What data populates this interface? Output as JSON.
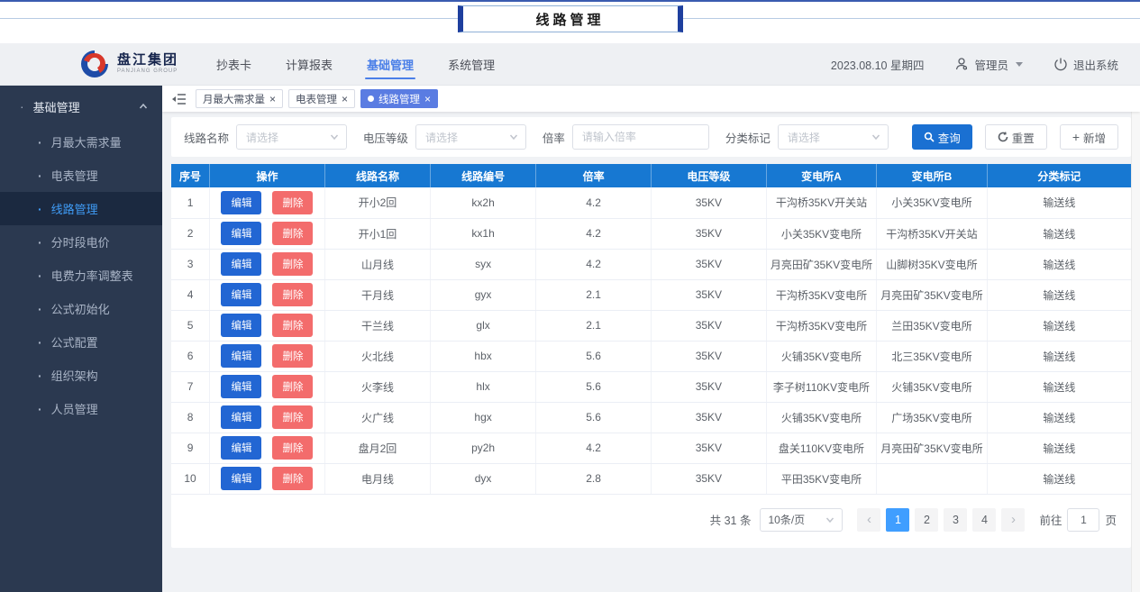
{
  "page_title": "线路管理",
  "header": {
    "logo_cn": "盘江集团",
    "logo_en": "PANJIANG GROUP",
    "nav": [
      {
        "label": "抄表卡",
        "active": false
      },
      {
        "label": "计算报表",
        "active": false
      },
      {
        "label": "基础管理",
        "active": true
      },
      {
        "label": "系统管理",
        "active": false
      }
    ],
    "date": "2023.08.10 星期四",
    "user": "管理员",
    "logout": "退出系统"
  },
  "sidebar": {
    "group_label": "基础管理",
    "items": [
      {
        "label": "月最大需求量",
        "active": false
      },
      {
        "label": "电表管理",
        "active": false
      },
      {
        "label": "线路管理",
        "active": true
      },
      {
        "label": "分时段电价",
        "active": false
      },
      {
        "label": "电费力率调整表",
        "active": false
      },
      {
        "label": "公式初始化",
        "active": false
      },
      {
        "label": "公式配置",
        "active": false
      },
      {
        "label": "组织架构",
        "active": false
      },
      {
        "label": "人员管理",
        "active": false
      }
    ]
  },
  "tabs": [
    {
      "label": "月最大需求量",
      "active": false
    },
    {
      "label": "电表管理",
      "active": false
    },
    {
      "label": "线路管理",
      "active": true
    }
  ],
  "filters": {
    "line_name_label": "线路名称",
    "line_name_placeholder": "请选择",
    "voltage_label": "电压等级",
    "voltage_placeholder": "请选择",
    "ratio_label": "倍率",
    "ratio_placeholder": "请输入倍率",
    "category_label": "分类标记",
    "category_placeholder": "请选择",
    "search_button": "查询",
    "reset_button": "重置",
    "add_button": "新增"
  },
  "table": {
    "headers": [
      "序号",
      "操作",
      "线路名称",
      "线路编号",
      "倍率",
      "电压等级",
      "变电所A",
      "变电所B",
      "分类标记"
    ],
    "edit_label": "编辑",
    "delete_label": "删除",
    "rows": [
      {
        "no": "1",
        "name": "开小2回",
        "code": "kx2h",
        "ratio": "4.2",
        "voltage": "35KV",
        "sub_a": "干沟桥35KV开关站",
        "sub_b": "小关35KV变电所",
        "category": "输送线"
      },
      {
        "no": "2",
        "name": "开小1回",
        "code": "kx1h",
        "ratio": "4.2",
        "voltage": "35KV",
        "sub_a": "小关35KV变电所",
        "sub_b": "干沟桥35KV开关站",
        "category": "输送线"
      },
      {
        "no": "3",
        "name": "山月线",
        "code": "syx",
        "ratio": "4.2",
        "voltage": "35KV",
        "sub_a": "月亮田矿35KV变电所",
        "sub_b": "山脚树35KV变电所",
        "category": "输送线"
      },
      {
        "no": "4",
        "name": "干月线",
        "code": "gyx",
        "ratio": "2.1",
        "voltage": "35KV",
        "sub_a": "干沟桥35KV变电所",
        "sub_b": "月亮田矿35KV变电所",
        "category": "输送线"
      },
      {
        "no": "5",
        "name": "干兰线",
        "code": "glx",
        "ratio": "2.1",
        "voltage": "35KV",
        "sub_a": "干沟桥35KV变电所",
        "sub_b": "兰田35KV变电所",
        "category": "输送线"
      },
      {
        "no": "6",
        "name": "火北线",
        "code": "hbx",
        "ratio": "5.6",
        "voltage": "35KV",
        "sub_a": "火铺35KV变电所",
        "sub_b": "北三35KV变电所",
        "category": "输送线"
      },
      {
        "no": "7",
        "name": "火李线",
        "code": "hlx",
        "ratio": "5.6",
        "voltage": "35KV",
        "sub_a": "李子树110KV变电所",
        "sub_b": "火铺35KV变电所",
        "category": "输送线"
      },
      {
        "no": "8",
        "name": "火广线",
        "code": "hgx",
        "ratio": "5.6",
        "voltage": "35KV",
        "sub_a": "火铺35KV变电所",
        "sub_b": "广场35KV变电所",
        "category": "输送线"
      },
      {
        "no": "9",
        "name": "盘月2回",
        "code": "py2h",
        "ratio": "4.2",
        "voltage": "35KV",
        "sub_a": "盘关110KV变电所",
        "sub_b": "月亮田矿35KV变电所",
        "category": "输送线"
      },
      {
        "no": "10",
        "name": "电月线",
        "code": "dyx",
        "ratio": "2.8",
        "voltage": "35KV",
        "sub_a": "平田35KV变电所",
        "sub_b": "",
        "category": "输送线"
      }
    ]
  },
  "pagination": {
    "total_text": "共 31 条",
    "page_size": "10条/页",
    "pages": [
      "1",
      "2",
      "3",
      "4"
    ],
    "active_page": "1",
    "goto_label": "前往",
    "goto_value": "1",
    "goto_suffix": "页"
  },
  "icons": {
    "close": "×",
    "bullet": "·",
    "prev": "‹",
    "next": "›",
    "plus": "+"
  },
  "colors": {
    "table_header": "#1778d2",
    "tab_active": "#5a7ce2",
    "primary_button": "#1a70d2",
    "edit_button": "#2266d3",
    "delete_button": "#f36c6c",
    "pagination_active": "#409eff",
    "sidebar_bg": "#2b3950",
    "sidebar_active_bg": "#1b2940",
    "sidebar_active_text": "#3f9bf5",
    "nav_active": "#4a7fe8",
    "title_bar_border": "#1e3f9e"
  }
}
